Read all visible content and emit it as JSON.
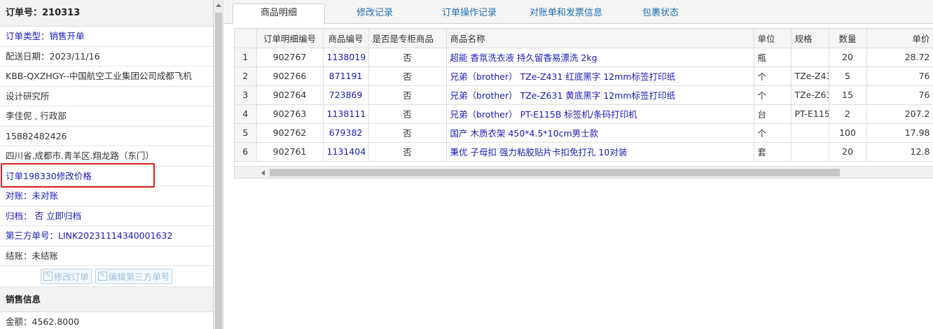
{
  "order": {
    "header": "订单号：210313",
    "type": "订单类型：销售开单",
    "delivery_date": "配送日期：2023/11/16",
    "customer_line1": "KBB-QXZHGY--中国航空工业集团公司成都飞机",
    "customer_line2": "设计研究所",
    "contact": "李佳伲 , 行政部",
    "phone": "15882482426",
    "address": "四川省.成都市.青羊区.翔龙路（东门）",
    "price_change": "订单198330修改价格",
    "reconcile": "对账：未对账",
    "archive": "归档： 否 立即归档",
    "third_party": "第三方单号：LINK20231114340001632",
    "settle": "结账：未结账",
    "btn_edit_order": "修改订单",
    "btn_edit_third": "编辑第三方单号",
    "sales_section": "销售信息",
    "amount": "金额：4562.8000"
  },
  "tabs": [
    {
      "label": "商品明细"
    },
    {
      "label": "修改记录"
    },
    {
      "label": "订单操作记录"
    },
    {
      "label": "对账单和发票信息"
    },
    {
      "label": "包裹状态"
    }
  ],
  "table": {
    "columns": [
      "",
      "订单明细编号",
      "商品编号",
      "是否是专柜商品",
      "商品名称",
      "单位",
      "规格",
      "数量",
      "单价"
    ],
    "rows": [
      {
        "idx": "1",
        "detail_id": "902767",
        "sku": "1138019",
        "counter": "否",
        "name": "超能 香氛洗衣液 持久留香易漂洗 2kg",
        "unit": "瓶",
        "spec": "",
        "qty": "20",
        "price": "28.72"
      },
      {
        "idx": "2",
        "detail_id": "902766",
        "sku": "871191",
        "counter": "否",
        "name": "兄弟（brother） TZe-Z431 红底黑字 12mm标签打印纸",
        "unit": "个",
        "spec": "TZe-Z43",
        "qty": "5",
        "price": "76"
      },
      {
        "idx": "3",
        "detail_id": "902764",
        "sku": "723869",
        "counter": "否",
        "name": "兄弟（brother） TZe-Z631 黄底黑字 12mm标签打印纸",
        "unit": "个",
        "spec": "TZe-Z63",
        "qty": "15",
        "price": "76"
      },
      {
        "idx": "4",
        "detail_id": "902763",
        "sku": "1138111",
        "counter": "否",
        "name": "兄弟（brother） PT-E115B 标签机/条码打印机",
        "unit": "台",
        "spec": "PT-E115",
        "qty": "2",
        "price": "207.2"
      },
      {
        "idx": "5",
        "detail_id": "902762",
        "sku": "679382",
        "counter": "否",
        "name": "国产 木质衣架 450*4.5*10cm男士款",
        "unit": "个",
        "spec": "",
        "qty": "100",
        "price": "17.98"
      },
      {
        "idx": "6",
        "detail_id": "902761",
        "sku": "1131404",
        "counter": "否",
        "name": "秉优 子母扣 强力粘胶贴片卡扣免打孔 10对装",
        "unit": "套",
        "spec": "",
        "qty": "20",
        "price": "12.8"
      }
    ]
  },
  "colors": {
    "link": "#1a1ab8",
    "tab_link": "#1f6fb2",
    "highlight_border": "#e02020"
  }
}
